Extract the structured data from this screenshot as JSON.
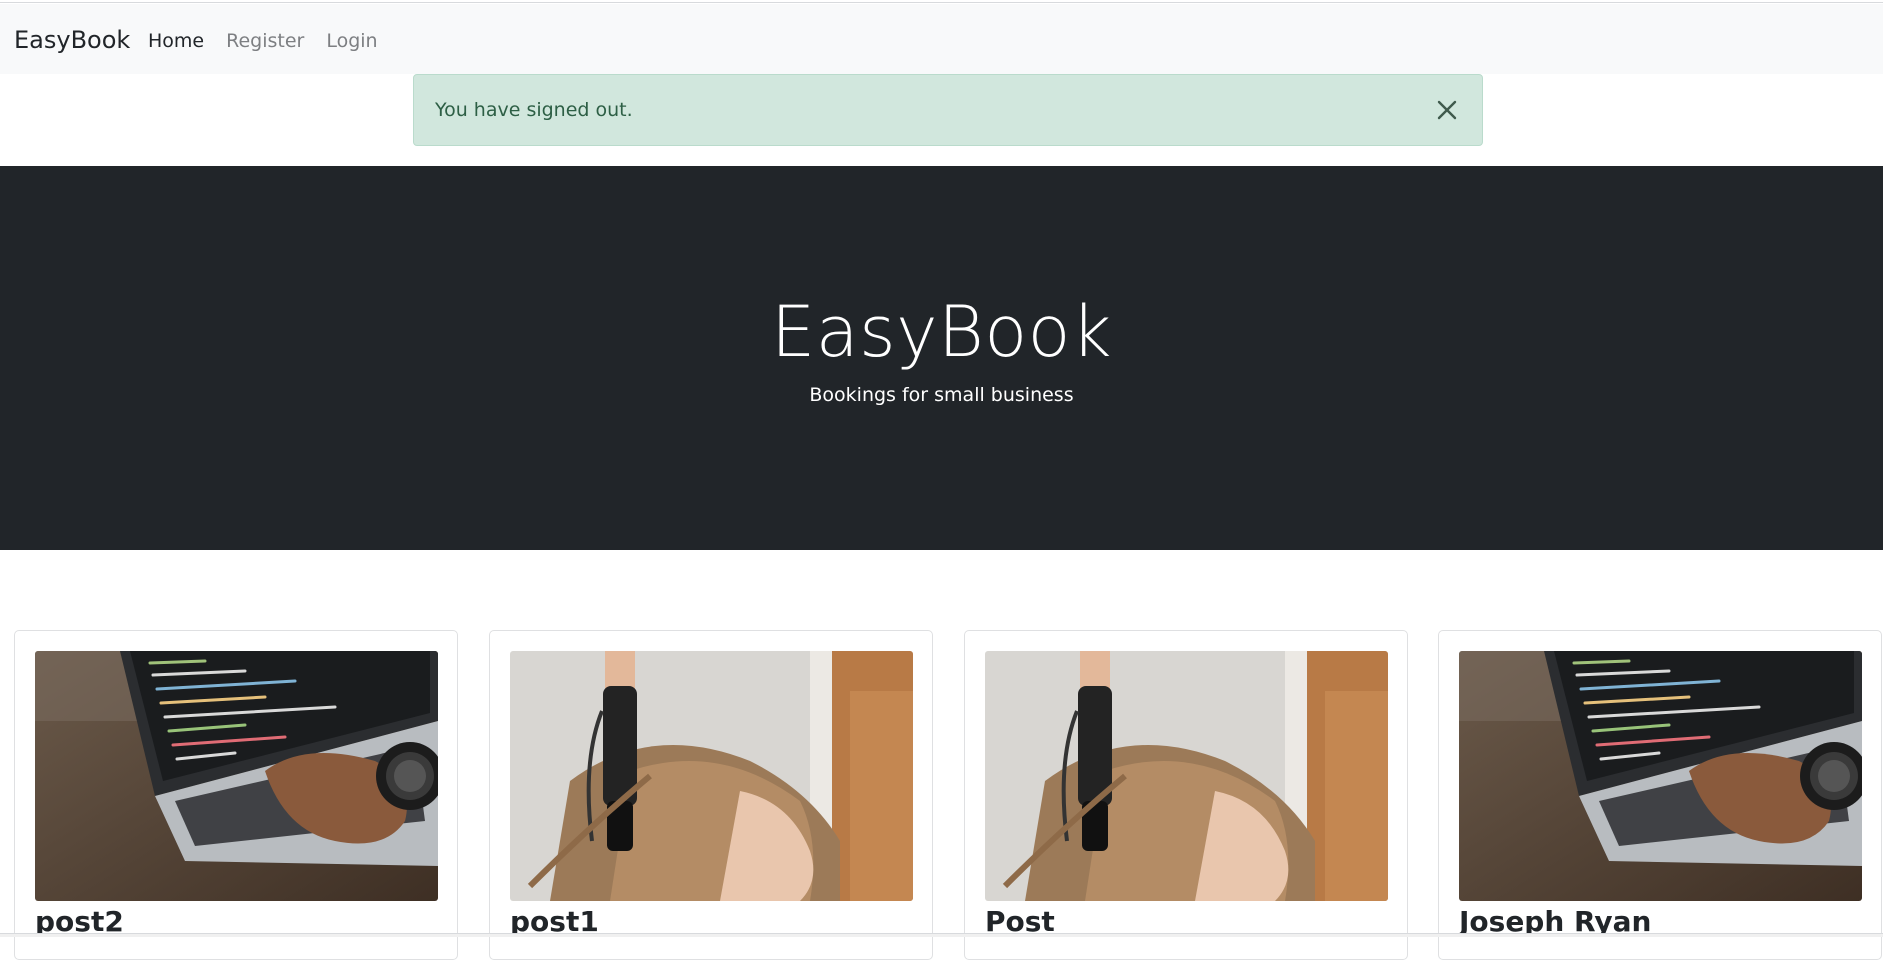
{
  "navbar": {
    "brand": "EasyBook",
    "links": [
      {
        "label": "Home",
        "active": true
      },
      {
        "label": "Register",
        "active": false
      },
      {
        "label": "Login",
        "active": false
      }
    ]
  },
  "alert": {
    "message": "You have signed out.",
    "close_icon": "close-icon",
    "color": "#d1e7dd"
  },
  "hero": {
    "title": "EasyBook",
    "subtitle": "Bookings for small business",
    "background": "#212529"
  },
  "cards": [
    {
      "title": "post2",
      "image": "laptop-coding-photo"
    },
    {
      "title": "post1",
      "image": "hair-curling-photo"
    },
    {
      "title": "Post",
      "image": "hair-curling-photo"
    },
    {
      "title": "Joseph Ryan",
      "image": "laptop-coding-photo"
    }
  ]
}
